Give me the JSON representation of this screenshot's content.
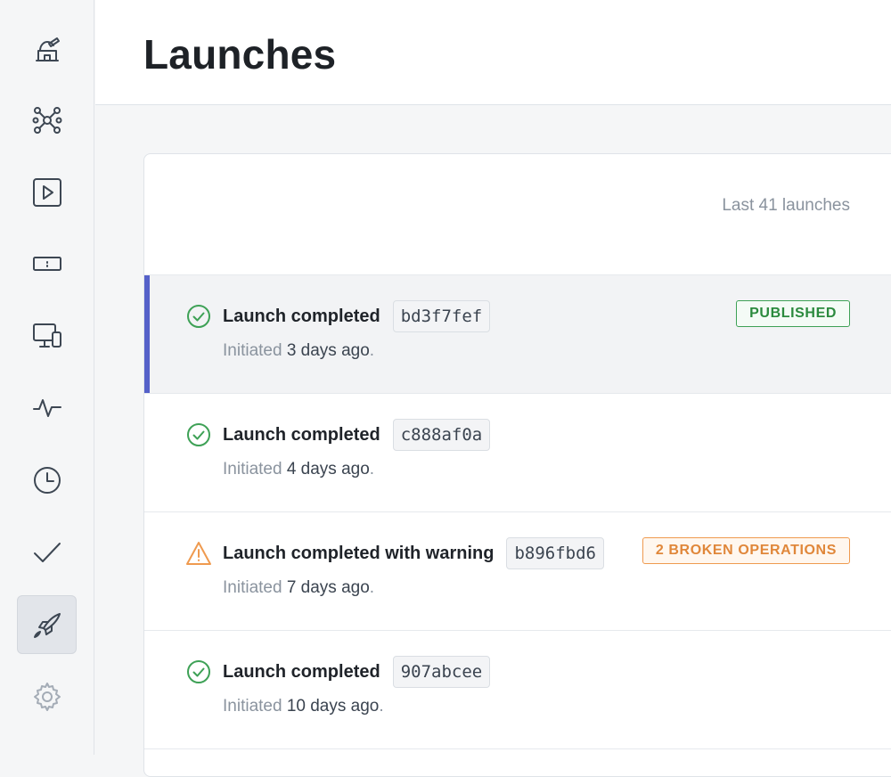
{
  "app": {
    "title": "Launches"
  },
  "sidebar": {
    "items": [
      {
        "name": "observatory-icon"
      },
      {
        "name": "network-icon"
      },
      {
        "name": "play-icon"
      },
      {
        "name": "ticket-icon"
      },
      {
        "name": "devices-icon"
      },
      {
        "name": "activity-icon"
      },
      {
        "name": "clock-icon"
      },
      {
        "name": "check-icon"
      },
      {
        "name": "rocket-icon",
        "active": true
      },
      {
        "name": "gear-icon"
      }
    ]
  },
  "launches": {
    "count_label": "Last 41 launches",
    "initiated_prefix": "Initiated",
    "rows": [
      {
        "status": "Launch completed",
        "hash": "bd3f7fef",
        "time": "3 days ago",
        "badge": "PUBLISHED",
        "badge_type": "published",
        "icon": "check-circle-icon",
        "selected": true
      },
      {
        "status": "Launch completed",
        "hash": "c888af0a",
        "time": "4 days ago",
        "badge": "",
        "badge_type": "",
        "icon": "check-circle-icon",
        "selected": false
      },
      {
        "status": "Launch completed with warning",
        "hash": "b896fbd6",
        "time": "7 days ago",
        "badge": "2 BROKEN OPERATIONS",
        "badge_type": "warning",
        "icon": "warning-icon",
        "selected": false
      },
      {
        "status": "Launch completed",
        "hash": "907abcee",
        "time": "10 days ago",
        "badge": "",
        "badge_type": "",
        "icon": "check-circle-icon",
        "selected": false
      }
    ]
  },
  "colors": {
    "accent": "#5561c9",
    "success": "#3ea156",
    "warning": "#ef9a4f"
  }
}
